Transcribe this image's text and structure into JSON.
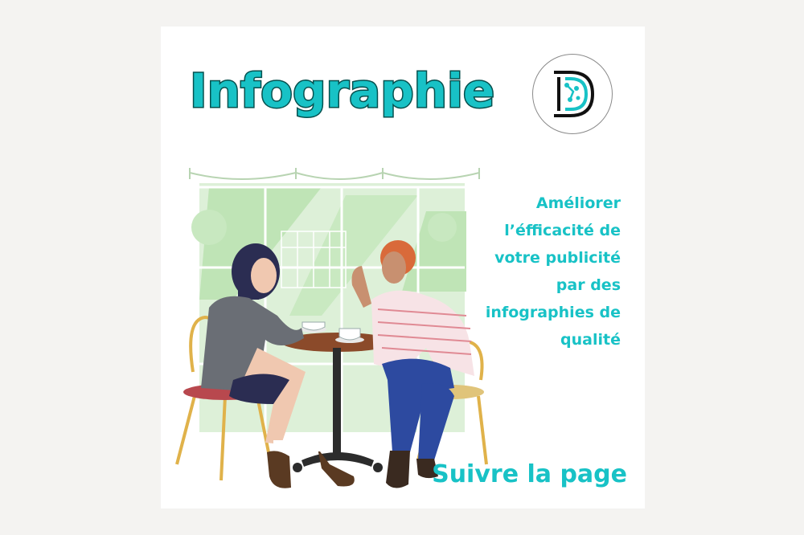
{
  "title": "Infographie",
  "tagline_lines": [
    "Améliorer",
    "l’éfficacité de",
    "votre publicité",
    "par des",
    "infographies de",
    "qualité"
  ],
  "cta": "Suivre la page",
  "logo": {
    "icon": "stylized-d-circuit-logo",
    "letter": "D"
  },
  "illustration": {
    "icon": "two-women-cafe-conversation"
  },
  "colors": {
    "accent": "#18c2c6",
    "title_outline": "#06504e",
    "page_background": "#f4f3f1",
    "card_background": "#ffffff"
  }
}
